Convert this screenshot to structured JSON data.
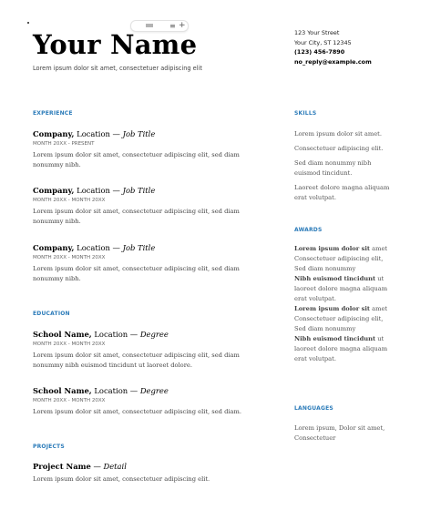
{
  "header": {
    "name": "Your Name",
    "tagline": "Lorem ipsum dolor sit amet, consectetuer adipiscing elit",
    "address_line1": "123 Your Street",
    "address_line2": "Your City, ST 12345",
    "phone": "(123) 456-7890",
    "email": "no_reply@example.com"
  },
  "toolbar": {
    "icons": [
      "drag-grip-icon",
      "sort-lines-icon",
      "plus-icon"
    ]
  },
  "experience": {
    "title": "EXPERIENCE",
    "entries": [
      {
        "company": "Company,",
        "location": " Location — ",
        "role": "Job Title",
        "date": "MONTH 20XX - PRESENT",
        "desc": "Lorem ipsum dolor sit amet, consectetuer adipiscing elit, sed diam nonummy nibh."
      },
      {
        "company": "Company,",
        "location": " Location — ",
        "role": "Job Title",
        "date": "MONTH 20XX - MONTH 20XX",
        "desc": "Lorem ipsum dolor sit amet, consectetuer adipiscing elit, sed diam nonummy nibh."
      },
      {
        "company": "Company,",
        "location": " Location — ",
        "role": "Job Title",
        "date": "MONTH 20XX - MONTH 20XX",
        "desc": "Lorem ipsum dolor sit amet, consectetuer adipiscing elit, sed diam nonummy nibh."
      }
    ]
  },
  "education": {
    "title": "EDUCATION",
    "entries": [
      {
        "school": "School Name,",
        "location": " Location — ",
        "degree": "Degree",
        "date": "MONTH 20XX - MONTH 20XX",
        "desc": "Lorem ipsum dolor sit amet, consectetuer adipiscing elit, sed diam nonummy nibh euismod tincidunt ut laoreet dolore."
      },
      {
        "school": "School Name,",
        "location": " Location — ",
        "degree": "Degree",
        "date": "MONTH 20XX - MONTH 20XX",
        "desc": "Lorem ipsum dolor sit amet, consectetuer adipiscing elit, sed diam."
      }
    ]
  },
  "projects": {
    "title": "PROJECTS",
    "entries": [
      {
        "name": "Project Name",
        "sep": " — ",
        "detail": "Detail",
        "desc": "Lorem ipsum dolor sit amet, consectetuer adipiscing elit."
      }
    ]
  },
  "skills": {
    "title": "SKILLS",
    "items": [
      "Lorem ipsum dolor sit amet.",
      "Consectetuer adipiscing elit.",
      "Sed diam nonummy nibh euismod tincidunt.",
      "Laoreet dolore magna aliquam erat volutpat."
    ]
  },
  "awards": {
    "title": "AWARDS",
    "items": [
      {
        "bold": "Lorem ipsum dolor sit",
        "text": " amet Consectetuer adipiscing elit, Sed diam nonummy"
      },
      {
        "bold": "Nibh euismod tincidunt",
        "text": " ut laoreet dolore magna aliquam erat volutpat."
      },
      {
        "bold": "Lorem ipsum dolor sit",
        "text": " amet Consectetuer adipiscing elit, Sed diam nonummy"
      },
      {
        "bold": "Nibh euismod tincidunt",
        "text": " ut laoreet dolore magna aliquam erat volutpat."
      }
    ]
  },
  "languages": {
    "title": "LANGUAGES",
    "text": "Lorem ipsum, Dolor sit amet, Consectetuer"
  },
  "colors": {
    "accent": "#2b7bb9",
    "text": "#333333"
  }
}
